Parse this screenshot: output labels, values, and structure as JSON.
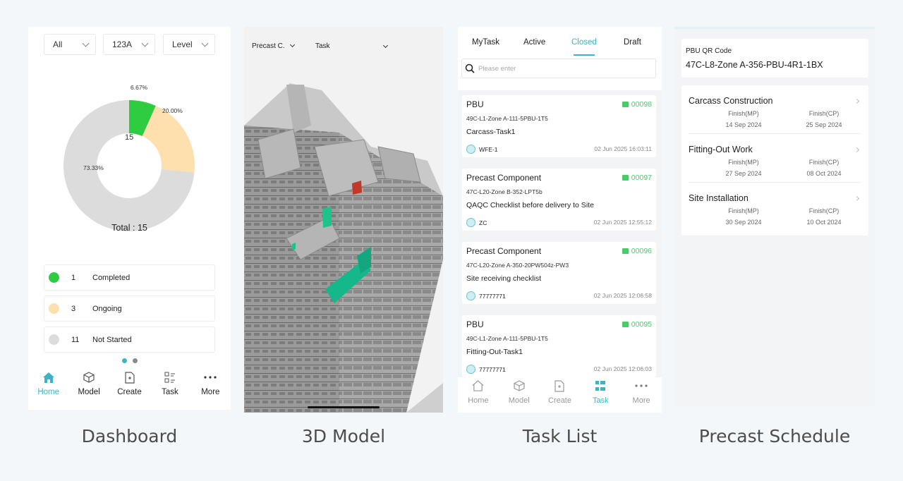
{
  "captions": {
    "dashboard": "Dashboard",
    "model": "3D Model",
    "tasks": "Task List",
    "schedule": "Precast Schedule"
  },
  "dashboard": {
    "filters": [
      "All",
      "123A",
      "Level"
    ],
    "donut_center": "15",
    "total_label": "Total : 15",
    "slices": [
      {
        "label": "6.67%",
        "value": 6.67,
        "color": "#2ecc40"
      },
      {
        "label": "20.00%",
        "value": 20.0,
        "color": "#fde0ad"
      },
      {
        "label": "73.33%",
        "value": 73.33,
        "color": "#dcdcdc"
      }
    ],
    "legend": [
      {
        "count": "1",
        "label": "Completed",
        "color": "#2ecc40"
      },
      {
        "count": "3",
        "label": "Ongoing",
        "color": "#fde0ad"
      },
      {
        "count": "11",
        "label": "Not Started",
        "color": "#dcdcdc"
      }
    ],
    "tabs": [
      "Home",
      "Model",
      "Create",
      "Task",
      "More"
    ],
    "active_tab": "Home"
  },
  "model": {
    "component_select": "Precast C.",
    "task_select": "Task"
  },
  "tasks": {
    "tabs": [
      "MyTask",
      "Active",
      "Closed",
      "Draft"
    ],
    "selected_tab": "Closed",
    "search_placeholder": "Please enter",
    "cards": [
      {
        "type": "PBU",
        "number": "00098",
        "code": "49C-L1-Zone A-111-5PBU-1T5",
        "title": "Carcass-Task1",
        "user": "WFE-1",
        "time": "02 Jun 2025 16:03:11"
      },
      {
        "type": "Precast Component",
        "number": "00097",
        "code": "47C-L20-Zone B-352-LPT5b",
        "title": "QAQC Checklist before delivery to Site",
        "user": "ZC",
        "time": "02 Jun 2025 12:55:12"
      },
      {
        "type": "Precast Component",
        "number": "00096",
        "code": "47C-L20-Zone A-350-20PW504z-PW3",
        "title": "Site receiving checklist",
        "user": "77777771",
        "time": "02 Jun 2025 12:06:58"
      },
      {
        "type": "PBU",
        "number": "00095",
        "code": "49C-L1-Zone A-111-5PBU-1T5",
        "title": "Fitting-Out-Task1",
        "user": "77777771",
        "time": "02 Jun 2025 12:06:03"
      }
    ],
    "bottom_tabs": [
      "Home",
      "Model",
      "Create",
      "Task",
      "More"
    ],
    "active_tab": "Task"
  },
  "schedule": {
    "qr_label": "PBU QR Code",
    "qr_value": "47C-L8-Zone A-356-PBU-4R1-1BX",
    "rows": [
      {
        "name": "Carcass Construction",
        "mp_label": "Finish(MP)",
        "cp_label": "Finish(CP)",
        "mp_date": "14 Sep 2024",
        "cp_date": "25 Sep 2024"
      },
      {
        "name": "Fitting-Out Work",
        "mp_label": "Finish(MP)",
        "cp_label": "Finish(CP)",
        "mp_date": "27 Sep 2024",
        "cp_date": "08 Oct 2024"
      },
      {
        "name": "Site Installation",
        "mp_label": "Finish(MP)",
        "cp_label": "Finish(CP)",
        "mp_date": "30 Sep 2024",
        "cp_date": "10 Oct 2024"
      }
    ]
  }
}
